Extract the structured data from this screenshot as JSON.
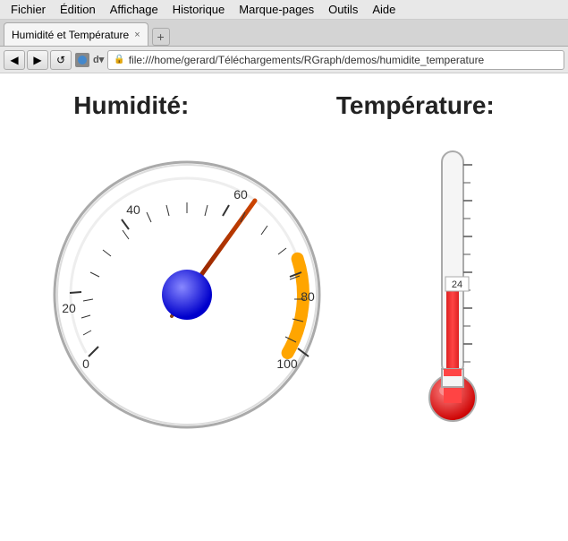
{
  "menubar": {
    "items": [
      "Fichier",
      "Édition",
      "Affichage",
      "Historique",
      "Marque-pages",
      "Outils",
      "Aide"
    ]
  },
  "tabbar": {
    "tab_label": "Humidité et Température",
    "tab_close": "×",
    "tab_new": "+"
  },
  "navbar": {
    "back": "◀",
    "forward": "▶",
    "refresh": "↺",
    "address": "file:///home/gerard/Téléchargements/RGraph/demos/humidite_temperature"
  },
  "main": {
    "humidity_title": "Humidité:",
    "temperature_title": "Température:",
    "temperature_value": "24"
  }
}
